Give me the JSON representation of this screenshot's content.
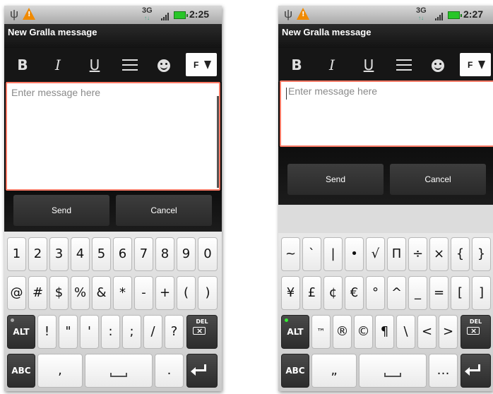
{
  "screens": [
    {
      "status": {
        "network": "3G",
        "time": "2:25"
      },
      "title": "New Gralla message",
      "toolbar": {
        "bold": "B",
        "italic": "I",
        "underline": "U",
        "font": "F"
      },
      "message": {
        "placeholder": "Enter message here"
      },
      "buttons": {
        "send": "Send",
        "cancel": "Cancel"
      },
      "keyboard": {
        "row1": [
          "1",
          "2",
          "3",
          "4",
          "5",
          "6",
          "7",
          "8",
          "9",
          "0"
        ],
        "row2": [
          "@",
          "#",
          "$",
          "%",
          "&",
          "*",
          "-",
          "+",
          "(",
          ")"
        ],
        "row3": [
          "!",
          "\"",
          "'",
          ":",
          ";",
          "/",
          "?"
        ],
        "row4": [
          ",",
          "."
        ],
        "alt": "ALT",
        "abc": "ABC",
        "del": "DEL"
      }
    },
    {
      "status": {
        "network": "3G",
        "time": "2:27"
      },
      "title": "New Gralla message",
      "toolbar": {
        "bold": "B",
        "italic": "I",
        "underline": "U",
        "font": "F"
      },
      "message": {
        "placeholder": "Enter message here"
      },
      "buttons": {
        "send": "Send",
        "cancel": "Cancel"
      },
      "keyboard": {
        "row1": [
          "~",
          "`",
          "|",
          "•",
          "√",
          "Π",
          "÷",
          "×",
          "{",
          "}"
        ],
        "row2": [
          "¥",
          "£",
          "¢",
          "€",
          "°",
          "^",
          "_",
          "=",
          "[",
          "]"
        ],
        "row3": [
          "™",
          "®",
          "©",
          "¶",
          "\\",
          "<",
          ">"
        ],
        "row4": [
          "„",
          "…"
        ],
        "alt": "ALT",
        "abc": "ABC",
        "del": "DEL"
      }
    }
  ],
  "colors": {
    "focus_border": "#ff7a66",
    "alt_on": "#33ee33",
    "battery": "#28c628",
    "warning": "#f08a00"
  }
}
